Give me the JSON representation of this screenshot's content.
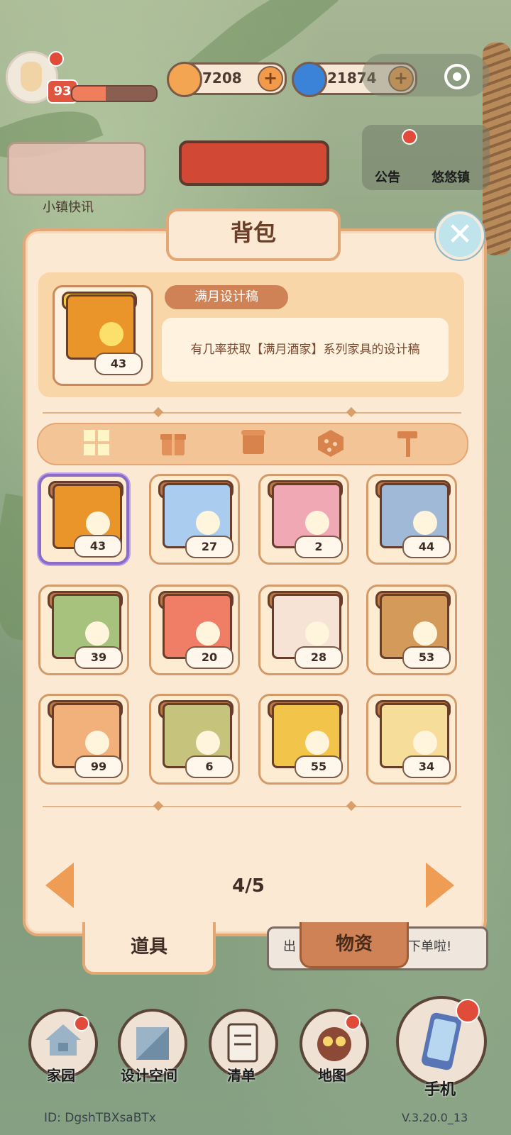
{
  "hud": {
    "level": "93",
    "xp_fraction": 0.4,
    "currency1_value": "7208",
    "currency2_value": "21874"
  },
  "town": {
    "news_label": "小镇快讯",
    "notice_label": "公告",
    "town_label": "悠悠镇"
  },
  "panel": {
    "title": "背包",
    "selected_item": {
      "name": "满月设计稿",
      "description": "有几率获取【满月酒家】系列家具的设计稿",
      "count": "43"
    },
    "category_tabs": [
      {
        "icon": "grid-icon"
      },
      {
        "icon": "gift-icon"
      },
      {
        "icon": "scroll-icon"
      },
      {
        "icon": "dice-icon"
      },
      {
        "icon": "hammer-icon"
      }
    ],
    "items": [
      {
        "count": "43",
        "color": "#e9952a",
        "icon": "full-moon-design-scroll"
      },
      {
        "count": "27",
        "color": "#a9ccef",
        "icon": "blue-flower-design-scroll"
      },
      {
        "count": "2",
        "color": "#f0a9b4",
        "icon": "pink-bow-ticket"
      },
      {
        "count": "44",
        "color": "#9fb9d6",
        "icon": "violet-flower-design-scroll"
      },
      {
        "count": "39",
        "color": "#a7c27d",
        "icon": "daisy-design-scroll"
      },
      {
        "count": "20",
        "color": "#f07d66",
        "icon": "red-flower-design-scroll"
      },
      {
        "count": "28",
        "color": "#f6e3d6",
        "icon": "rose-design-scroll"
      },
      {
        "count": "53",
        "color": "#d49a5a",
        "icon": "recipe-book"
      },
      {
        "count": "99",
        "color": "#f2b07a",
        "icon": "butterfly-design-scroll"
      },
      {
        "count": "6",
        "color": "#c6c47c",
        "icon": "butterfly-design-scroll-green"
      },
      {
        "count": "55",
        "color": "#f3c44a",
        "icon": "golden-ticket"
      },
      {
        "count": "34",
        "color": "#f6dd9a",
        "icon": "sparkle-design-scroll"
      }
    ],
    "page": "4/5",
    "tab_active": "道具",
    "tab_inactive": "物资"
  },
  "speech_bubble": {
    "left": "出",
    "right": "下单啦!"
  },
  "nav": [
    {
      "label": "家园"
    },
    {
      "label": "设计空间"
    },
    {
      "label": "清单"
    },
    {
      "label": "地图"
    },
    {
      "label": "手机"
    }
  ],
  "footer": {
    "id": "ID:  DgshTBXsaBTx",
    "version": "V.3.20.0_13"
  }
}
